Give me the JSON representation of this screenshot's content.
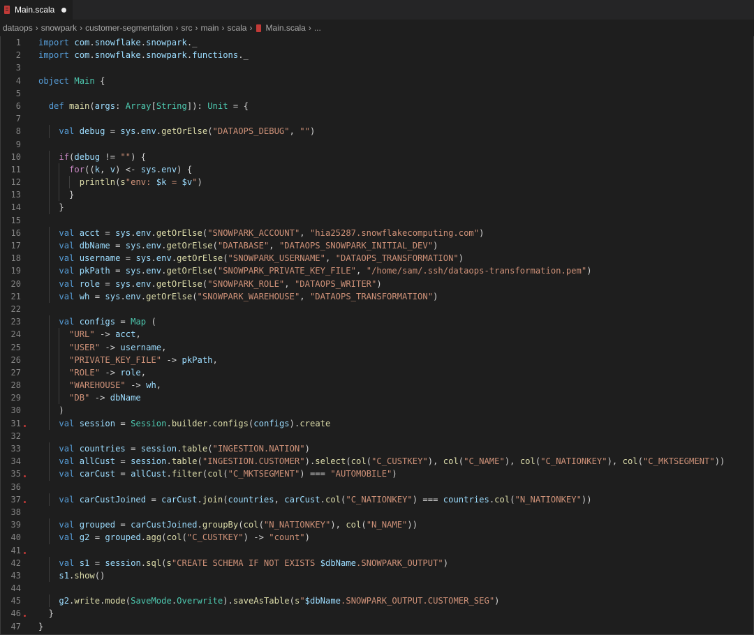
{
  "tab": {
    "filename": "Main.scala"
  },
  "breadcrumb": {
    "items": [
      "dataops",
      "snowpark",
      "customer-segmentation",
      "src",
      "main",
      "scala",
      "Main.scala",
      "..."
    ]
  },
  "editor": {
    "line_numbers": [
      "1",
      "2",
      "3",
      "4",
      "5",
      "6",
      "7",
      "8",
      "9",
      "10",
      "11",
      "12",
      "13",
      "14",
      "15",
      "16",
      "17",
      "18",
      "19",
      "20",
      "21",
      "22",
      "23",
      "24",
      "25",
      "26",
      "27",
      "28",
      "29",
      "30",
      "31",
      "32",
      "33",
      "34",
      "35",
      "36",
      "37",
      "38",
      "39",
      "40",
      "41",
      "42",
      "43",
      "44",
      "45",
      "46",
      "47"
    ],
    "lines": [
      "import com.snowflake.snowpark._",
      "import com.snowflake.snowpark.functions._",
      "",
      "object Main {",
      "",
      "  def main(args: Array[String]): Unit = {",
      "",
      "    val debug = sys.env.getOrElse(\"DATAOPS_DEBUG\", \"\")",
      "",
      "    if(debug != \"\") {",
      "      for((k, v) <- sys.env) {",
      "        println(s\"env: $k = $v\")",
      "      }",
      "    }",
      "",
      "    val acct = sys.env.getOrElse(\"SNOWPARK_ACCOUNT\", \"hia25287.snowflakecomputing.com\")",
      "    val dbName = sys.env.getOrElse(\"DATABASE\", \"DATAOPS_SNOWPARK_INITIAL_DEV\")",
      "    val username = sys.env.getOrElse(\"SNOWPARK_USERNAME\", \"DATAOPS_TRANSFORMATION\")",
      "    val pkPath = sys.env.getOrElse(\"SNOWPARK_PRIVATE_KEY_FILE\", \"/home/sam/.ssh/dataops-transformation.pem\")",
      "    val role = sys.env.getOrElse(\"SNOWPARK_ROLE\", \"DATAOPS_WRITER\")",
      "    val wh = sys.env.getOrElse(\"SNOWPARK_WAREHOUSE\", \"DATAOPS_TRANSFORMATION\")",
      "",
      "    val configs = Map (",
      "      \"URL\" -> acct,",
      "      \"USER\" -> username,",
      "      \"PRIVATE_KEY_FILE\" -> pkPath,",
      "      \"ROLE\" -> role,",
      "      \"WAREHOUSE\" -> wh,",
      "      \"DB\" -> dbName",
      "    )",
      "    val session = Session.builder.configs(configs).create",
      "",
      "    val countries = session.table(\"INGESTION.NATION\")",
      "    val allCust = session.table(\"INGESTION.CUSTOMER\").select(col(\"C_CUSTKEY\"), col(\"C_NAME\"), col(\"C_NATIONKEY\"), col(\"C_MKTSEGMENT\"))",
      "    val carCust = allCust.filter(col(\"C_MKTSEGMENT\") === \"AUTOMOBILE\")",
      "",
      "    val carCustJoined = carCust.join(countries, carCust.col(\"C_NATIONKEY\") === countries.col(\"N_NATIONKEY\"))",
      "",
      "    val grouped = carCustJoined.groupBy(col(\"N_NATIONKEY\"), col(\"N_NAME\"))",
      "    val g2 = grouped.agg(col(\"C_CUSTKEY\") -> \"count\")",
      "",
      "    val s1 = session.sql(s\"CREATE SCHEMA IF NOT EXISTS $dbName.SNOWPARK_OUTPUT\")",
      "    s1.show()",
      "",
      "    g2.write.mode(SaveMode.Overwrite).saveAsTable(s\"$dbName.SNOWPARK_OUTPUT.CUSTOMER_SEG\")",
      "  }",
      "}"
    ]
  },
  "colors": {
    "background": "#1e1e1e",
    "keyword": "#569cd6",
    "control": "#c586c0",
    "type": "#4ec9b0",
    "function": "#dcdcaa",
    "string": "#ce9178",
    "variable": "#9cdcfe",
    "breakpoint": "#c13a37"
  },
  "icons": [
    "scala-file-icon",
    "unsaved-dot-icon",
    "chevron-right-icon",
    "breakpoint-marker-icon"
  ]
}
